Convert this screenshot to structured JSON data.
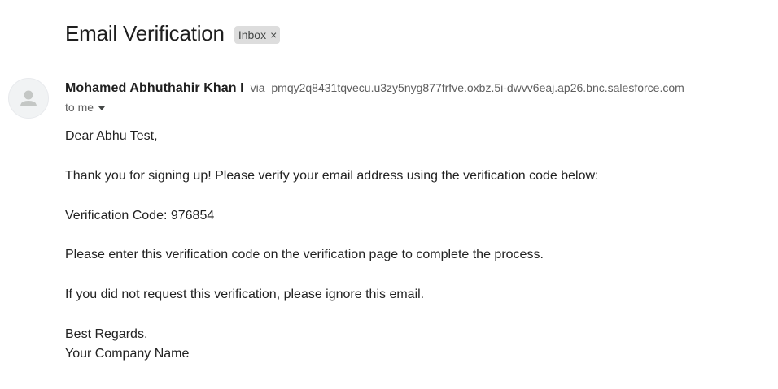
{
  "email": {
    "subject": "Email Verification",
    "label": "Inbox",
    "label_close": "×",
    "sender_name": "Mohamed Abhuthahir Khan I",
    "via": "via",
    "sender_address": "pmqy2q8431tqvecu.u3zy5nyg877frfve.oxbz.5i-dwvv6eaj.ap26.bnc.salesforce.com",
    "to": "to me",
    "body": {
      "greeting": "Dear Abhu Test,",
      "line1": "Thank you for signing up! Please verify your email address using the verification code below:",
      "code_line": "Verification Code: 976854",
      "line2": "Please enter this verification code on the verification page to complete the process.",
      "line3": "If you did not request this verification, please ignore this email.",
      "signoff": "Best Regards,",
      "signature": "Your Company Name"
    }
  }
}
